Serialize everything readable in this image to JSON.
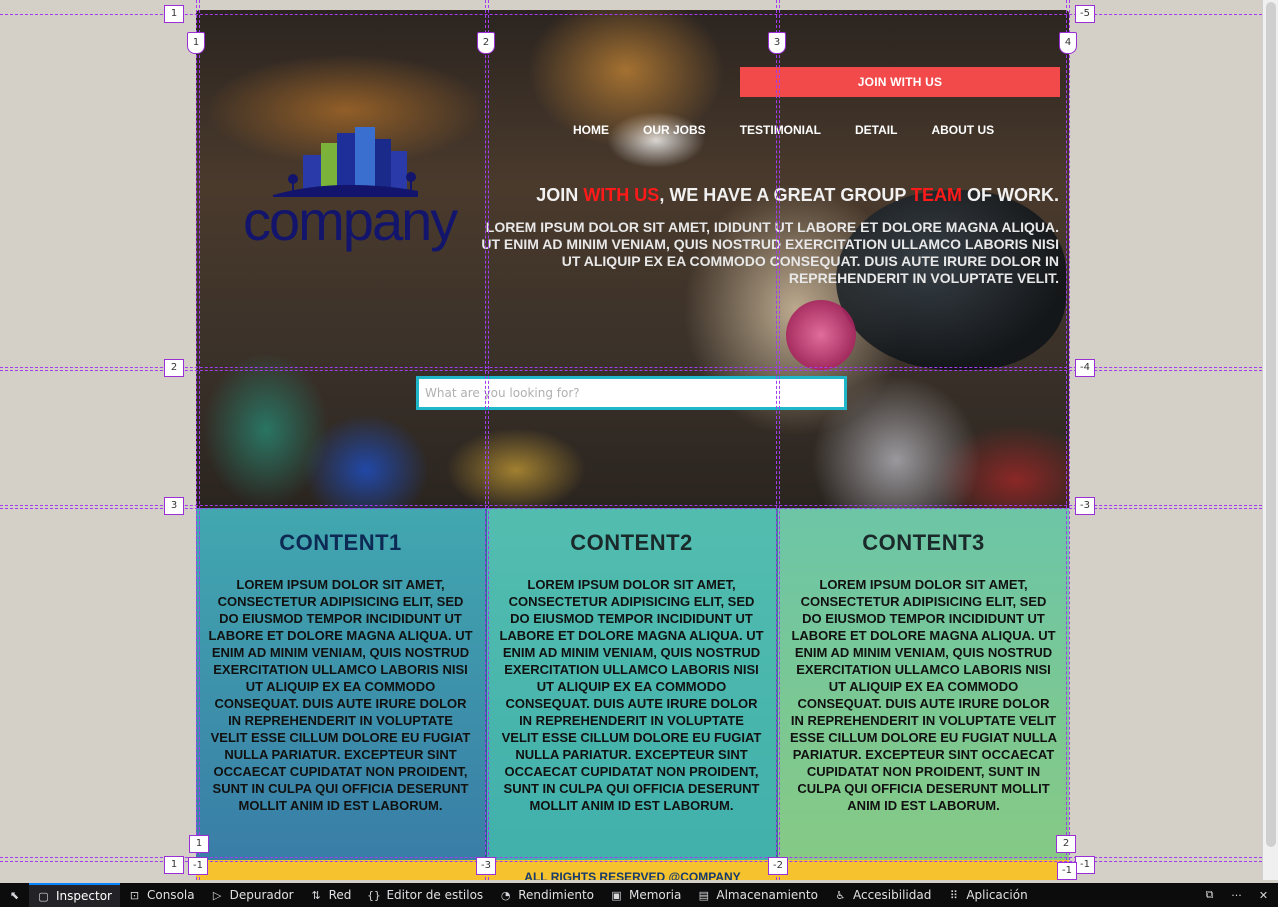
{
  "site": {
    "join_button": "JOIN WITH US",
    "nav": [
      "HOME",
      "OUR JOBS",
      "TESTIMONIAL",
      "DETAIL",
      "ABOUT US"
    ],
    "logo_text": "company",
    "headline": {
      "part1": "JOIN ",
      "part2": "WITH US",
      "part3": ", WE HAVE A GREAT GROUP ",
      "part4": "TEAM",
      "part5": " OF WORK."
    },
    "lead": "LOREM IPSUM DOLOR SIT AMET, IDIDUNT UT LABORE ET DOLORE MAGNA ALIQUA. UT ENIM AD MINIM VENIAM, QUIS NOSTRUD EXERCITATION ULLAMCO LABORIS NISI UT ALIQUIP EX EA COMMODO CONSEQUAT. DUIS AUTE IRURE DOLOR IN REPREHENDERIT IN VOLUPTATE VELIT.",
    "search_placeholder": "What are you looking for?",
    "contents": [
      {
        "title": "CONTENT1",
        "text": "LOREM IPSUM DOLOR SIT AMET, CONSECTETUR ADIPISICING ELIT, SED DO EIUSMOD TEMPOR INCIDIDUNT UT LABORE ET DOLORE MAGNA ALIQUA. UT ENIM AD MINIM VENIAM, QUIS NOSTRUD EXERCITATION ULLAMCO LABORIS NISI UT ALIQUIP EX EA COMMODO CONSEQUAT. DUIS AUTE IRURE DOLOR IN REPREHENDERIT IN VOLUPTATE VELIT ESSE CILLUM DOLORE EU FUGIAT NULLA PARIATUR. EXCEPTEUR SINT OCCAECAT CUPIDATAT NON PROIDENT, SUNT IN CULPA QUI OFFICIA DESERUNT MOLLIT ANIM ID EST LABORUM."
      },
      {
        "title": "CONTENT2",
        "text": "LOREM IPSUM DOLOR SIT AMET, CONSECTETUR ADIPISICING ELIT, SED DO EIUSMOD TEMPOR INCIDIDUNT UT LABORE ET DOLORE MAGNA ALIQUA. UT ENIM AD MINIM VENIAM, QUIS NOSTRUD EXERCITATION ULLAMCO LABORIS NISI UT ALIQUIP EX EA COMMODO CONSEQUAT. DUIS AUTE IRURE DOLOR IN REPREHENDERIT IN VOLUPTATE VELIT ESSE CILLUM DOLORE EU FUGIAT NULLA PARIATUR. EXCEPTEUR SINT OCCAECAT CUPIDATAT NON PROIDENT, SUNT IN CULPA QUI OFFICIA DESERUNT MOLLIT ANIM ID EST LABORUM."
      },
      {
        "title": "CONTENT3",
        "text": "LOREM IPSUM DOLOR SIT AMET, CONSECTETUR ADIPISICING ELIT, SED DO EIUSMOD TEMPOR INCIDIDUNT UT LABORE ET DOLORE MAGNA ALIQUA. UT ENIM AD MINIM VENIAM, QUIS NOSTRUD EXERCITATION ULLAMCO LABORIS NISI UT ALIQUIP EX EA COMMODO CONSEQUAT. DUIS AUTE IRURE DOLOR IN REPREHENDERIT IN VOLUPTATE VELIT ESSE CILLUM DOLORE EU FUGIAT NULLA PARIATUR. EXCEPTEUR SINT OCCAECAT CUPIDATAT NON PROIDENT, SUNT IN CULPA QUI OFFICIA DESERUNT MOLLIT ANIM ID EST LABORUM."
      }
    ],
    "footer": "ALL RIGHTS RESERVED @COMPANY"
  },
  "grid_overlay": {
    "left_rows": [
      "1",
      "2",
      "3",
      "1"
    ],
    "right_rows": [
      "-5",
      "-4",
      "-3",
      "-1"
    ],
    "top_cols": [
      "1",
      "2",
      "3",
      "4"
    ],
    "bottom_cols": [
      "1",
      "-1",
      "-3",
      "-2",
      "2",
      "-1"
    ]
  },
  "devtools": {
    "tabs": [
      {
        "label": "Inspector",
        "icon": "inspector-icon",
        "glyph": "▢"
      },
      {
        "label": "Consola",
        "icon": "console-icon",
        "glyph": "⊡"
      },
      {
        "label": "Depurador",
        "icon": "debugger-icon",
        "glyph": "▷"
      },
      {
        "label": "Red",
        "icon": "network-icon",
        "glyph": "⇅"
      },
      {
        "label": "Editor de estilos",
        "icon": "style-editor-icon",
        "glyph": "{}"
      },
      {
        "label": "Rendimiento",
        "icon": "performance-icon",
        "glyph": "◔"
      },
      {
        "label": "Memoria",
        "icon": "memory-icon",
        "glyph": "▣"
      },
      {
        "label": "Almacenamiento",
        "icon": "storage-icon",
        "glyph": "▤"
      },
      {
        "label": "Accesibilidad",
        "icon": "accessibility-icon",
        "glyph": "♿"
      },
      {
        "label": "Aplicación",
        "icon": "application-icon",
        "glyph": "⠿"
      }
    ],
    "pick_glyph": "⬉",
    "dock_glyph": "⧉",
    "more_glyph": "···",
    "close_glyph": "✕"
  },
  "colors": {
    "accent_red": "#f24a4a",
    "search_border": "#1eb6c8",
    "footer_bg": "#f6c22e",
    "grid_line": "#a23cf0",
    "devtools_active": "#0a84ff"
  }
}
